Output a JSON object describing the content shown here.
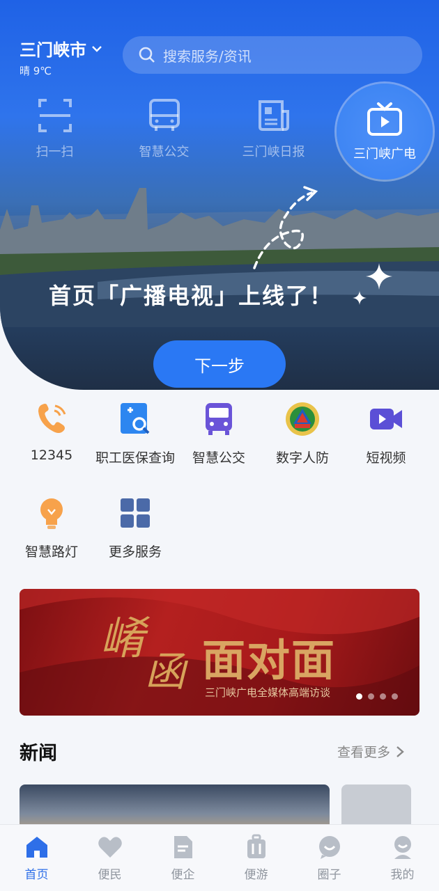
{
  "location": {
    "city": "三门峡市",
    "weather": "晴 9℃"
  },
  "search": {
    "placeholder": "搜索服务/资讯"
  },
  "top_shortcuts": [
    {
      "label": "扫一扫",
      "icon": "scan-icon"
    },
    {
      "label": "智慧公交",
      "icon": "bus-icon"
    },
    {
      "label": "三门峡日报",
      "icon": "newspaper-icon"
    },
    {
      "label": "三门峡广电",
      "icon": "tv-icon"
    }
  ],
  "guide": {
    "tip": "首页「广播电视」上线了！",
    "next_label": "下一步"
  },
  "services": [
    {
      "label": "12345",
      "icon": "phone-icon",
      "color": "#f7a24b"
    },
    {
      "label": "职工医保查询",
      "icon": "medical-search-icon",
      "color": "#2d86f0"
    },
    {
      "label": "智慧公交",
      "icon": "bus-icon",
      "color": "#6a54d8"
    },
    {
      "label": "数字人防",
      "icon": "civil-defense-icon",
      "color": "#d93a2e"
    },
    {
      "label": "短视频",
      "icon": "video-icon",
      "color": "#5b4fd6"
    },
    {
      "label": "智慧路灯",
      "icon": "lightbulb-icon",
      "color": "#f7a24b"
    },
    {
      "label": "更多服务",
      "icon": "grid-icon",
      "color": "#4b6aa8"
    }
  ],
  "banner": {
    "calligraphy_1": "崤",
    "calligraphy_2": "函",
    "title": "面对面",
    "subtitle": "三门峡广电全媒体高端访谈",
    "page_count": 4,
    "active_page": 1
  },
  "news": {
    "title": "新闻",
    "more_label": "查看更多"
  },
  "tabbar": [
    {
      "label": "首页",
      "icon": "home-icon",
      "active": true
    },
    {
      "label": "便民",
      "icon": "heart-icon",
      "active": false
    },
    {
      "label": "便企",
      "icon": "document-icon",
      "active": false
    },
    {
      "label": "便游",
      "icon": "luggage-icon",
      "active": false
    },
    {
      "label": "圈子",
      "icon": "chat-icon",
      "active": false
    },
    {
      "label": "我的",
      "icon": "profile-icon",
      "active": false
    }
  ],
  "colors": {
    "accent": "#2e6fe8",
    "hero_blue": "#1f62e6",
    "button_blue": "#2a78f4"
  }
}
